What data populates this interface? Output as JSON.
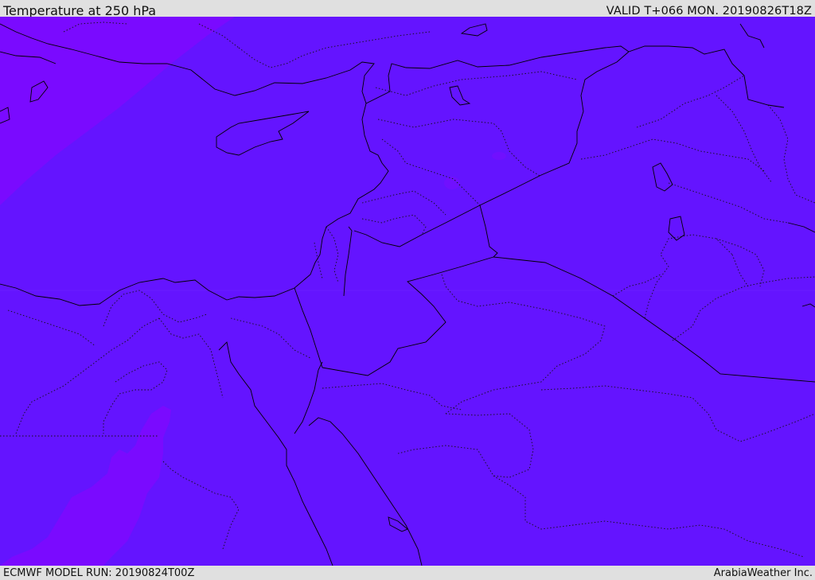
{
  "header": {
    "title": "Temperature at 250 hPa",
    "valid_time": "VALID T+066 MON. 20190826T18Z"
  },
  "footer": {
    "model_run": "ECMWF MODEL RUN: 20190824T00Z",
    "credit": "ArabiaWeather Inc."
  },
  "map": {
    "colors": {
      "warm_field": "#6414ff",
      "cool_field": "#7a0aff",
      "coastline": "#000000"
    }
  }
}
